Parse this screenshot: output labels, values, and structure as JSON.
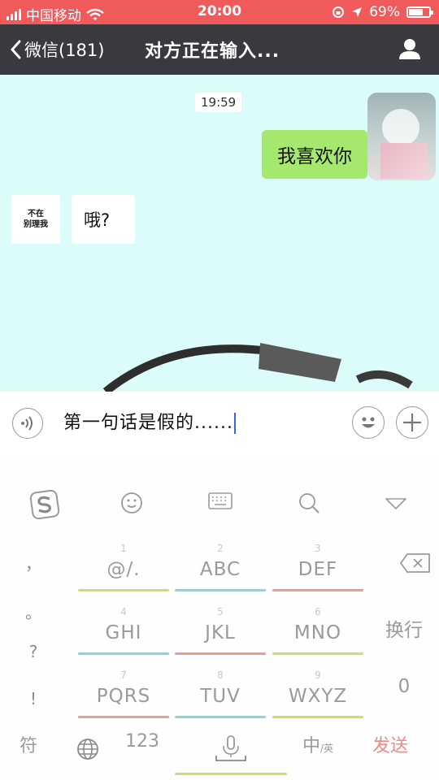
{
  "status_bar": {
    "carrier": "中国移动",
    "time": "20:00",
    "battery": "69%",
    "battery_level": 0.69
  },
  "nav": {
    "back_label": "微信(181)",
    "title": "对方正在输入..."
  },
  "chat": {
    "timestamp": "19:59",
    "messages": [
      {
        "side": "right",
        "text": "我喜欢你"
      },
      {
        "side": "left",
        "text": "哦?"
      }
    ],
    "other_avatar_lines": [
      "不在",
      "别理我"
    ]
  },
  "input": {
    "text": "第一句话是假的......"
  },
  "keyboard": {
    "keys": [
      {
        "num": "1",
        "label": "@/.",
        "color": "#c5e36a"
      },
      {
        "num": "2",
        "label": "ABC",
        "color": "#7ed9e3"
      },
      {
        "num": "3",
        "label": "DEF",
        "color": "#f19a8e"
      },
      {
        "num": "4",
        "label": "GHI",
        "color": "#7ed9e3"
      },
      {
        "num": "5",
        "label": "JKL",
        "color": "#f19a8e"
      },
      {
        "num": "6",
        "label": "MNO",
        "color": "#c5e36a"
      },
      {
        "num": "7",
        "label": "PQRS",
        "color": "#f19a8e"
      },
      {
        "num": "8",
        "label": "TUV",
        "color": "#7ed9e3"
      },
      {
        "num": "9",
        "label": "WXYZ",
        "color": "#c5e36a"
      }
    ],
    "side_keys": [
      "，",
      "。",
      "?",
      "!"
    ],
    "newline": "换行",
    "zero": "0",
    "symbols": "符",
    "numbers": "123",
    "lang_main": "中",
    "lang_sub": "/英",
    "send": "发送",
    "send_color": "#f08a8a"
  }
}
